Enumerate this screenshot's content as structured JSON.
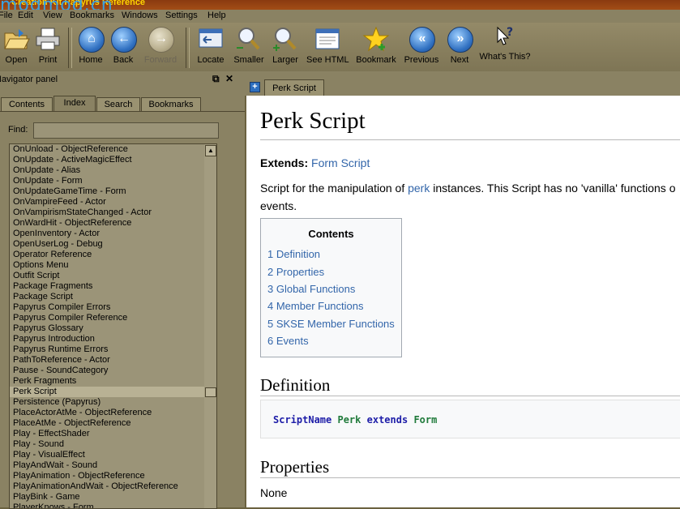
{
  "title": {
    "text": "Creation Kit Papyrus Reference",
    "watermark": "modmod.cn"
  },
  "menu": [
    "File",
    "Edit",
    "View",
    "Bookmarks",
    "Windows",
    "Settings",
    "Help"
  ],
  "toolbar": {
    "open": "Open",
    "print": "Print",
    "home": "Home",
    "back": "Back",
    "forward": "Forward",
    "locate": "Locate",
    "smaller": "Smaller",
    "larger": "Larger",
    "see_html": "See HTML",
    "bookmark": "Bookmark",
    "previous": "Previous",
    "next": "Next",
    "whats_this": "What's This?"
  },
  "nav": {
    "title": "Navigator panel",
    "float_icon": "float-icon",
    "close_icon": "close-icon",
    "tabs": [
      "Contents",
      "Index",
      "Search",
      "Bookmarks"
    ],
    "active_tab": "Index",
    "find_label": "Find:",
    "find_value": "",
    "items": [
      "OnUnload - ObjectReference",
      "OnUpdate - ActiveMagicEffect",
      "OnUpdate - Alias",
      "OnUpdate - Form",
      "OnUpdateGameTime - Form",
      "OnVampireFeed - Actor",
      "OnVampirismStateChanged - Actor",
      "OnWardHit - ObjectReference",
      "OpenInventory - Actor",
      "OpenUserLog - Debug",
      "Operator Reference",
      "Options Menu",
      "Outfit Script",
      "Package Fragments",
      "Package Script",
      "Papyrus Compiler Errors",
      "Papyrus Compiler Reference",
      "Papyrus Glossary",
      "Papyrus Introduction",
      "Papyrus Runtime Errors",
      "PathToReference - Actor",
      "Pause - SoundCategory",
      "Perk Fragments",
      "Perk Script",
      "Persistence (Papyrus)",
      "PlaceActorAtMe - ObjectReference",
      "PlaceAtMe - ObjectReference",
      "Play - EffectShader",
      "Play - Sound",
      "Play - VisualEffect",
      "PlayAndWait - Sound",
      "PlayAnimation - ObjectReference",
      "PlayAnimationAndWait - ObjectReference",
      "PlayBink - Game",
      "PlayerKnows - Form"
    ],
    "selected": "Perk Script"
  },
  "content": {
    "tab_label": "Perk Script",
    "heading": "Perk Script",
    "extends_label": "Extends:",
    "extends_link": "Form Script",
    "desc_before": "Script for the manipulation of ",
    "desc_link": "perk",
    "desc_after": " instances. This Script has no 'vanilla' functions o",
    "desc_line2": "events.",
    "toc_title": "Contents",
    "toc": [
      "1 Definition",
      "2 Properties",
      "3 Global Functions",
      "4 Member Functions",
      "5 SKSE Member Functions",
      "6 Events"
    ],
    "definition_heading": "Definition",
    "code": {
      "kw1": "ScriptName",
      "name": "Perk",
      "kw2": "extends",
      "parent": "Form"
    },
    "properties_heading": "Properties",
    "properties_value": "None"
  }
}
